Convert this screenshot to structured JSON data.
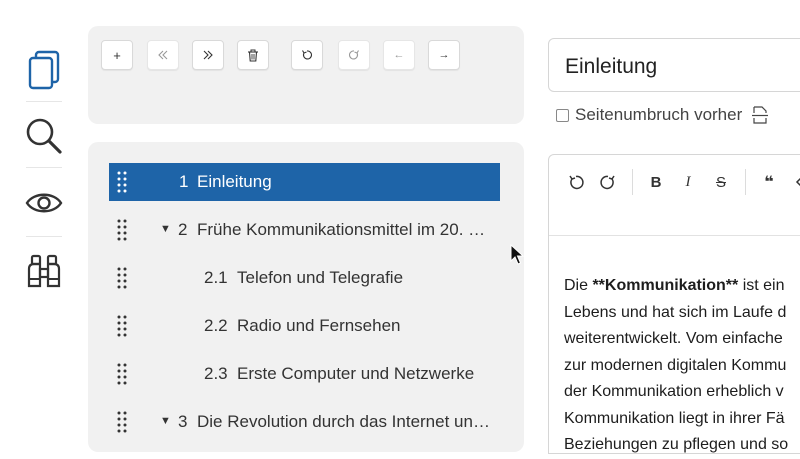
{
  "rail": {
    "icons": [
      "documents-icon",
      "search-icon",
      "eye-icon",
      "binoculars-icon"
    ]
  },
  "toolbar": {
    "buttons": [
      {
        "name": "add-button",
        "icon": "plus-icon",
        "text": "+"
      },
      {
        "name": "outdent-button",
        "icon": "double-chevron-left-icon",
        "text": "«"
      },
      {
        "name": "indent-button",
        "icon": "double-chevron-right-icon",
        "text": "»"
      },
      {
        "name": "delete-button",
        "icon": "trash-icon",
        "text": ""
      },
      {
        "name": "undo-button",
        "icon": "undo-icon",
        "text": ""
      },
      {
        "name": "redo-button",
        "icon": "redo-icon",
        "text": ""
      },
      {
        "name": "move-left-button",
        "icon": "arrow-left-icon",
        "text": "←"
      },
      {
        "name": "move-right-button",
        "icon": "arrow-right-icon",
        "text": "→"
      }
    ]
  },
  "outline": {
    "items": [
      {
        "num": "1",
        "label": "Einleitung",
        "selected": true,
        "level": 1,
        "expandable": false
      },
      {
        "num": "2",
        "label": "Frühe Kommunikationsmittel im 20. …",
        "selected": false,
        "level": 1,
        "expandable": true
      },
      {
        "num": "2.1",
        "label": "Telefon und Telegrafie",
        "selected": false,
        "level": 2,
        "expandable": false
      },
      {
        "num": "2.2",
        "label": "Radio und Fernsehen",
        "selected": false,
        "level": 2,
        "expandable": false
      },
      {
        "num": "2.3",
        "label": "Erste Computer und Netzwerke",
        "selected": false,
        "level": 2,
        "expandable": false
      },
      {
        "num": "3",
        "label": "Die Revolution durch das Internet un…",
        "selected": false,
        "level": 1,
        "expandable": true
      }
    ]
  },
  "editor": {
    "title": "Einleitung",
    "page_break_label": "Seitenumbruch vorher",
    "page_break_checked": false,
    "toolbar": [
      "undo-icon",
      "redo-icon",
      "bold-icon",
      "italic-icon",
      "strikethrough-icon",
      "quote-icon",
      "code-icon"
    ],
    "bold_label": "B",
    "italic_label": "I",
    "strike_label": "S",
    "quote_label": "❝",
    "text_lines": [
      {
        "before": "Die ",
        "bold": "**Kommunikation**",
        "after": " ist ein"
      },
      {
        "before": "Lebens und hat sich im Laufe d",
        "bold": "",
        "after": ""
      },
      {
        "before": "weiterentwickelt. Vom einfache",
        "bold": "",
        "after": ""
      },
      {
        "before": "zur modernen digitalen Kommu",
        "bold": "",
        "after": ""
      },
      {
        "before": "der Kommunikation erheblich v",
        "bold": "",
        "after": ""
      },
      {
        "before": "Kommunikation liegt in ihrer Fä",
        "bold": "",
        "after": ""
      },
      {
        "before": "Beziehungen zu pflegen und so",
        "bold": "",
        "after": ""
      }
    ]
  },
  "colors": {
    "accent": "#1e64a8",
    "panel": "#f1f1f1"
  }
}
